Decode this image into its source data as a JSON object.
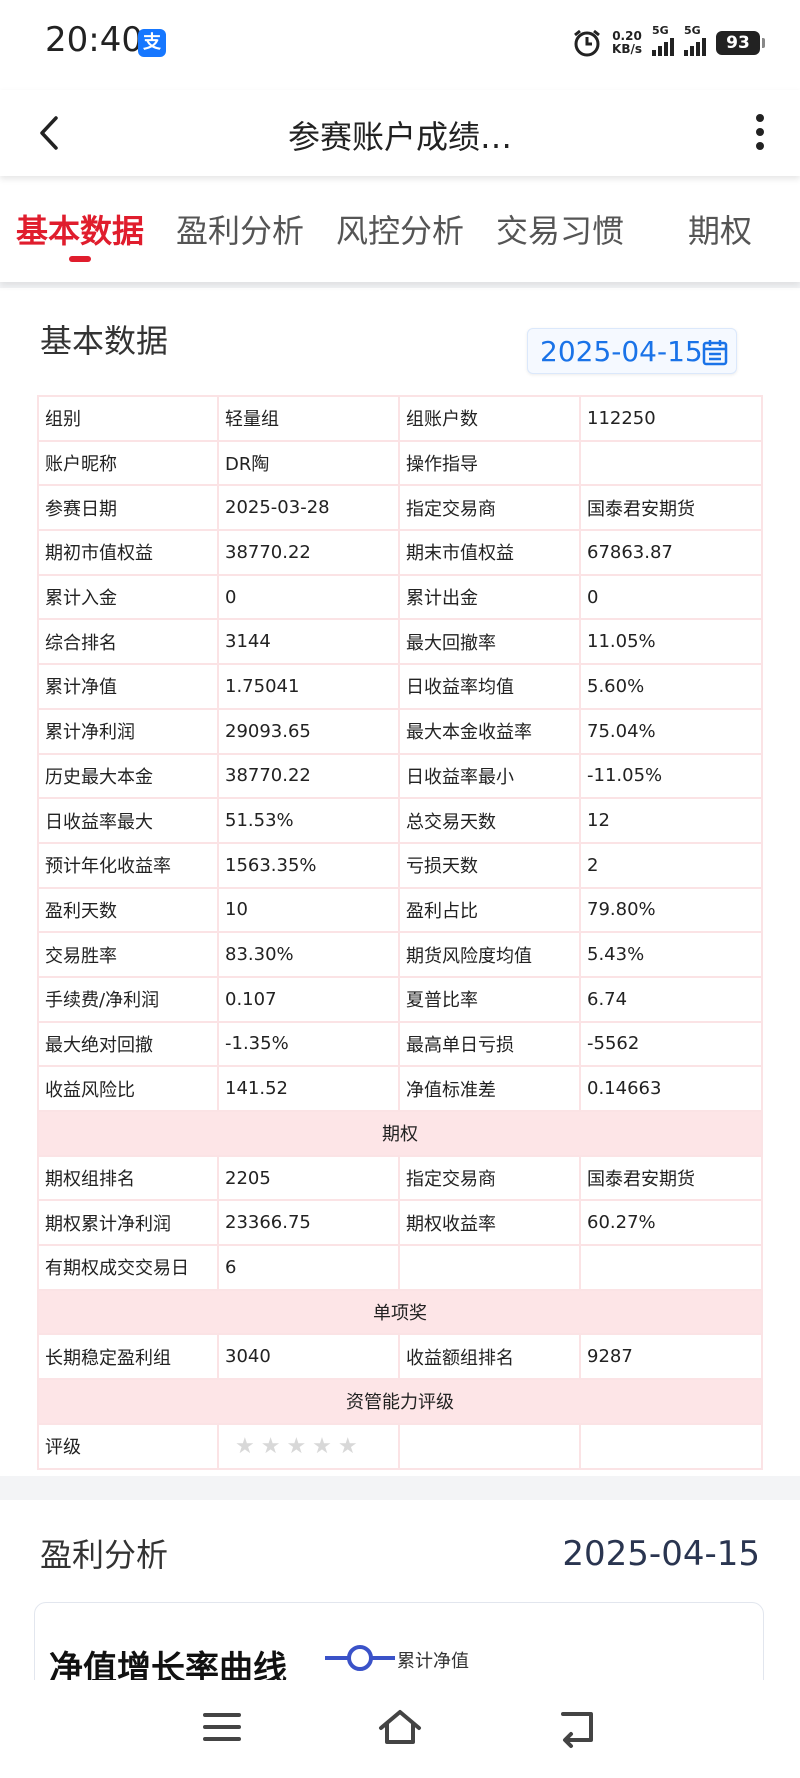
{
  "status_bar": {
    "time": "20:40",
    "app_badge": "支",
    "net_speed_value": "0.20",
    "net_speed_unit": "KB/s",
    "signal1_label": "5G",
    "signal2_label": "5G",
    "battery": "93"
  },
  "header": {
    "title": "参赛账户成绩…"
  },
  "tabs": [
    {
      "label": "基本数据",
      "active": true
    },
    {
      "label": "盈利分析",
      "active": false
    },
    {
      "label": "风控分析",
      "active": false
    },
    {
      "label": "交易习惯",
      "active": false
    },
    {
      "label": "期权",
      "active": false
    }
  ],
  "basic": {
    "title": "基本数据",
    "date": "2025-04-15",
    "rows": [
      [
        "组别",
        "轻量组",
        "组账户数",
        "112250"
      ],
      [
        "账户昵称",
        "DR陶",
        "操作指导",
        ""
      ],
      [
        "参赛日期",
        "2025-03-28",
        "指定交易商",
        "国泰君安期货"
      ],
      [
        "期初市值权益",
        "38770.22",
        "期末市值权益",
        "67863.87"
      ],
      [
        "累计入金",
        "0",
        "累计出金",
        "0"
      ],
      [
        "综合排名",
        "3144",
        "最大回撤率",
        "11.05%"
      ],
      [
        "累计净值",
        "1.75041",
        "日收益率均值",
        "5.60%"
      ],
      [
        "累计净利润",
        "29093.65",
        "最大本金收益率",
        "75.04%"
      ],
      [
        "历史最大本金",
        "38770.22",
        "日收益率最小",
        "-11.05%"
      ],
      [
        "日收益率最大",
        "51.53%",
        "总交易天数",
        "12"
      ],
      [
        "预计年化收益率",
        "1563.35%",
        "亏损天数",
        "2"
      ],
      [
        "盈利天数",
        "10",
        "盈利占比",
        "79.80%"
      ],
      [
        "交易胜率",
        "83.30%",
        "期货风险度均值",
        "5.43%"
      ],
      [
        "手续费/净利润",
        "0.107",
        "夏普比率",
        "6.74"
      ],
      [
        "最大绝对回撤",
        "-1.35%",
        "最高单日亏损",
        "-5562"
      ],
      [
        "收益风险比",
        "141.52",
        "净值标准差",
        "0.14663"
      ]
    ],
    "option_header": "期权",
    "option_rows": [
      [
        "期权组排名",
        "2205",
        "指定交易商",
        "国泰君安期货"
      ],
      [
        "期权累计净利润",
        "23366.75",
        "期权收益率",
        "60.27%"
      ],
      [
        "有期权成交交易日",
        "6",
        "",
        ""
      ]
    ],
    "award_header": "单项奖",
    "award_rows": [
      [
        "长期稳定盈利组",
        "3040",
        "收益额组排名",
        "9287"
      ]
    ],
    "rating_header": "资管能力评级",
    "rating_label": "评级",
    "rating_stars": "★★★★★",
    "rating_value": 0
  },
  "profit": {
    "title": "盈利分析",
    "date": "2025-04-15",
    "chart_title": "净值增长率曲线",
    "legend": "累计净值"
  }
}
